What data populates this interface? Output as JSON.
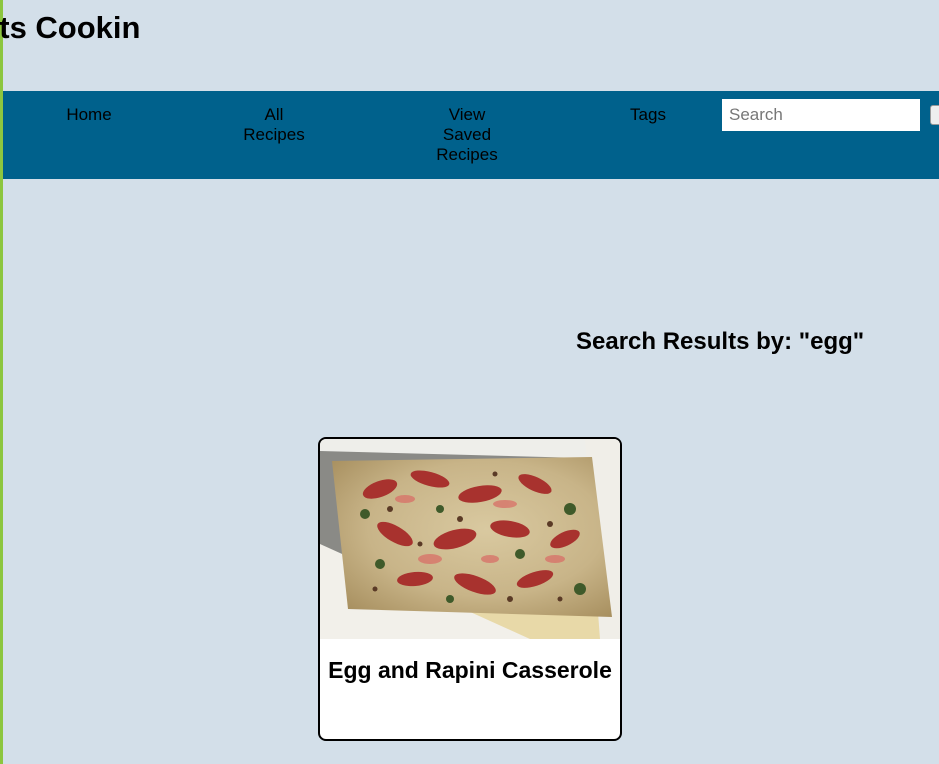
{
  "header": {
    "site_title": "ats Cookin"
  },
  "nav": {
    "home": "Home",
    "all_recipes": [
      "All",
      "Recipes"
    ],
    "saved_recipes": [
      "View",
      "Saved",
      "Recipes"
    ],
    "tags": "Tags",
    "search_placeholder": "Search"
  },
  "results": {
    "heading": "Search Results by: \"egg\""
  },
  "recipes": [
    {
      "title": "Egg and Rapini Casserole",
      "image": "casserole-photo"
    }
  ],
  "colors": {
    "background": "#d3dfe9",
    "navbar": "#00618c",
    "accent_edge": "#8cc63f"
  }
}
